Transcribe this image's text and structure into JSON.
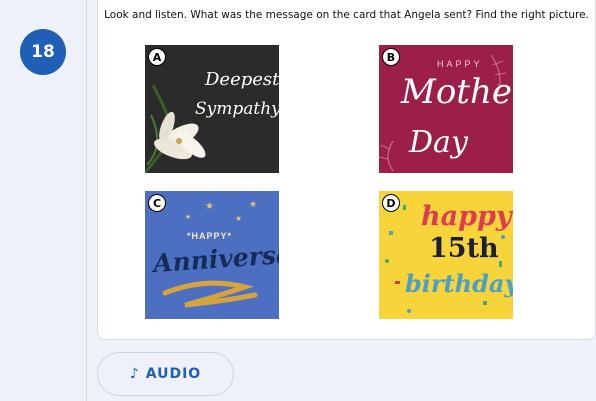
{
  "question_number": "18",
  "question_text": "Look and listen. What was the message on the card that Angela sent? Find the right picture.",
  "options": [
    {
      "letter": "A",
      "lines": [
        "Deepest",
        "Sympathy"
      ]
    },
    {
      "letter": "B",
      "lines": [
        "HAPPY",
        "Mother's",
        "Day"
      ]
    },
    {
      "letter": "C",
      "lines": [
        "*HAPPY*",
        "Anniversary!"
      ]
    },
    {
      "letter": "D",
      "lines": [
        "happy",
        "15th",
        "birthday"
      ]
    }
  ],
  "audio_label": "AUDIO",
  "audio_icon": "music-note-icon",
  "colors": {
    "accent": "#1f5fb5",
    "card_a": "#2b2b2b",
    "card_b": "#9c1f4a",
    "card_c": "#4d6fc2",
    "card_d": "#f7d53a"
  }
}
